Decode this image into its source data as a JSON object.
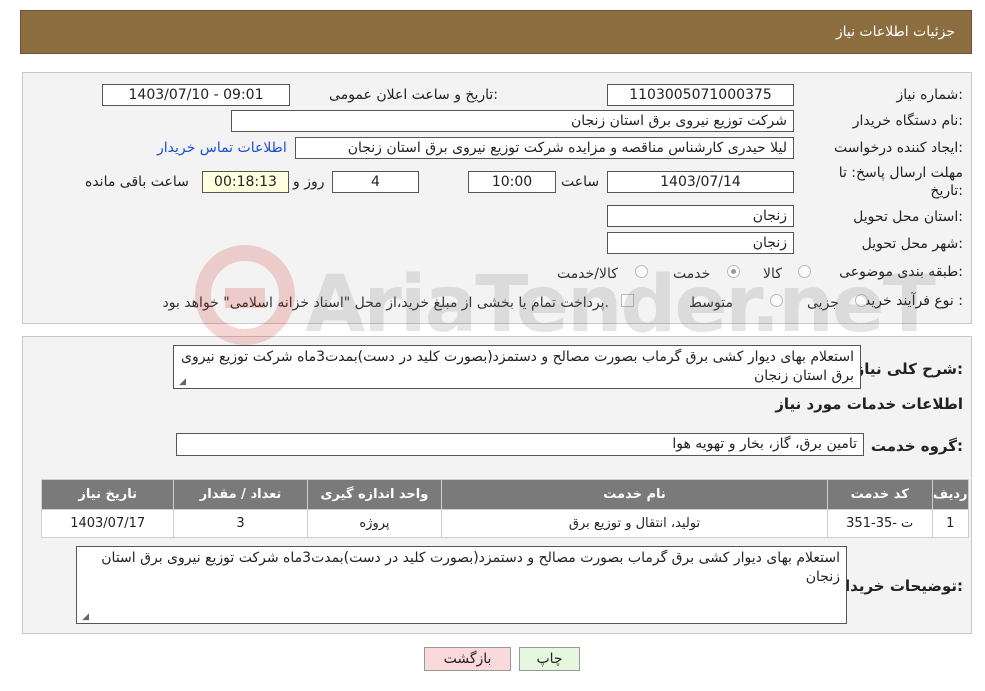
{
  "header": {
    "title": "جزئیات اطلاعات نیاز"
  },
  "info": {
    "need_number_label": "شماره نیاز:",
    "need_number": "1103005071000375",
    "announce_label": "تاریخ و ساعت اعلان عمومی:",
    "announce_value": "1403/07/10 - 09:01",
    "buyer_org_label": "نام دستگاه خریدار:",
    "buyer_org": "شرکت توزیع نیروی برق استان زنجان",
    "creator_label": "ایجاد کننده درخواست:",
    "creator": "لیلا حیدری کارشناس مناقصه و مزایده شرکت توزیع نیروی برق استان زنجان",
    "contact_link": "اطلاعات تماس خریدار",
    "deadline_label_1": "مهلت ارسال پاسخ: تا",
    "deadline_label_2": "تاریخ:",
    "deadline_date": "1403/07/14",
    "time_label": "ساعت",
    "deadline_time": "10:00",
    "days_value": "4",
    "days_label": "روز و",
    "remaining_value": "00:18:13",
    "remaining_label": "ساعت باقی مانده",
    "province_label": "استان محل تحویل:",
    "province": "زنجان",
    "city_label": "شهر محل تحویل:",
    "city": "زنجان",
    "category_label": "طبقه بندی موضوعی:",
    "category_options": [
      "کالا",
      "خدمت",
      "کالا/خدمت"
    ],
    "category_selected": "خدمت",
    "process_label": "نوع فرآیند خرید :",
    "process_options": [
      "جزیی",
      "متوسط"
    ],
    "payment_note": "پرداخت تمام یا بخشی از مبلغ خرید،از محل \"اسناد خزانه اسلامی\" خواهد بود."
  },
  "details": {
    "summary_label": "شرح کلی نیاز:",
    "summary": "استعلام بهای دیوار کشی برق گرماب بصورت مصالح و دستمزد(بصورت کلید در دست)بمدت3ماه شرکت توزیع نیروی برق استان زنجان",
    "services_heading": "اطلاعات خدمات مورد نیاز",
    "group_label": "گروه خدمت:",
    "group_value": "تامین برق، گاز، بخار و تهویه هوا",
    "table": {
      "headers": [
        "ردیف",
        "کد خدمت",
        "نام خدمت",
        "واحد اندازه گیری",
        "تعداد / مقدار",
        "تاریخ نیاز"
      ],
      "rows": [
        [
          "1",
          "ت -35-351",
          "تولید، انتقال و توزیع برق",
          "پروژه",
          "3",
          "1403/07/17"
        ]
      ]
    },
    "buyer_notes_label": "توضیحات خریدار:",
    "buyer_notes": "استعلام بهای دیوار کشی برق گرماب بصورت مصالح و دستمزد(بصورت کلید در دست)بمدت3ماه شرکت توزیع نیروی برق استان زنجان"
  },
  "buttons": {
    "print": "چاپ",
    "back": "بازگشت"
  },
  "watermark": {
    "text": "AriaTender.neT"
  },
  "colors": {
    "header_bg": "#8b6d40",
    "link": "#1a4fd6",
    "table_header": "#7a7a7a",
    "back_btn": "#f9d9d9",
    "print_btn": "#e6f7df"
  }
}
